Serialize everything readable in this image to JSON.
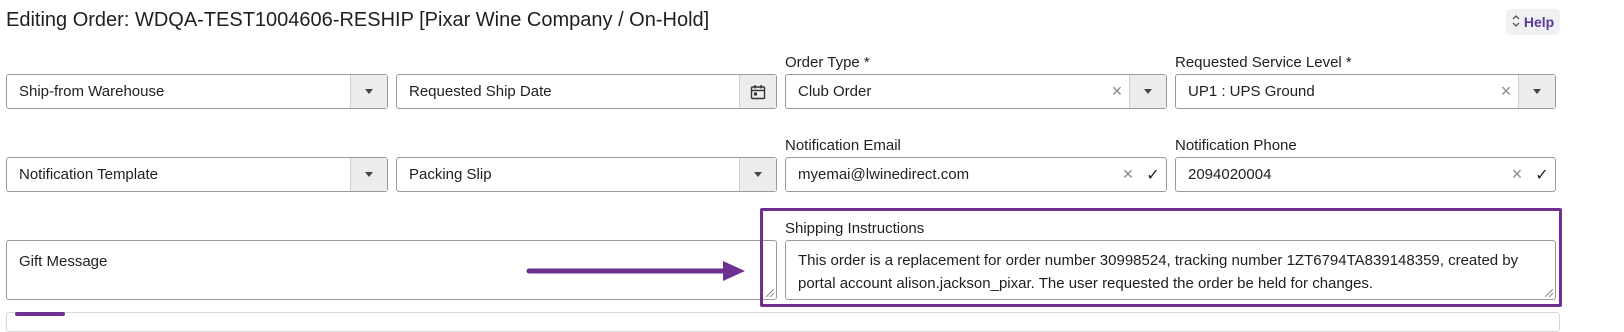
{
  "header": {
    "title": "Editing Order: WDQA-TEST1004606-RESHIP [Pixar Wine Company / On-Hold]",
    "help_label": "Help"
  },
  "row1": {
    "warehouse": {
      "value": "Ship-from Warehouse"
    },
    "ship_date": {
      "value": "Requested Ship Date"
    },
    "order_type": {
      "label": "Order Type *",
      "value": "Club Order"
    },
    "service_level": {
      "label": "Requested Service Level *",
      "value": "UP1 : UPS Ground"
    }
  },
  "row2": {
    "notification_template": {
      "value": "Notification Template"
    },
    "packing_slip": {
      "value": "Packing Slip"
    },
    "notification_email": {
      "label": "Notification Email",
      "value": "myemai@lwinedirect.com"
    },
    "notification_phone": {
      "label": "Notification Phone",
      "value": "2094020004"
    }
  },
  "row3": {
    "gift_message": {
      "value": "Gift Message"
    },
    "shipping_instructions": {
      "label": "Shipping Instructions",
      "value": "This order is a replacement for order number 30998524, tracking number 1ZT6794TA839148359, created by portal account alison.jackson_pixar. The user requested the order be held for changes."
    }
  },
  "icons": {
    "clear": "×",
    "check": "✓",
    "help_caret": "⌃⌄"
  },
  "colors": {
    "accent": "#6f2f8f",
    "help_text": "#5b3a9a",
    "border": "#9a9a9a",
    "addon_bg": "#ececec"
  }
}
